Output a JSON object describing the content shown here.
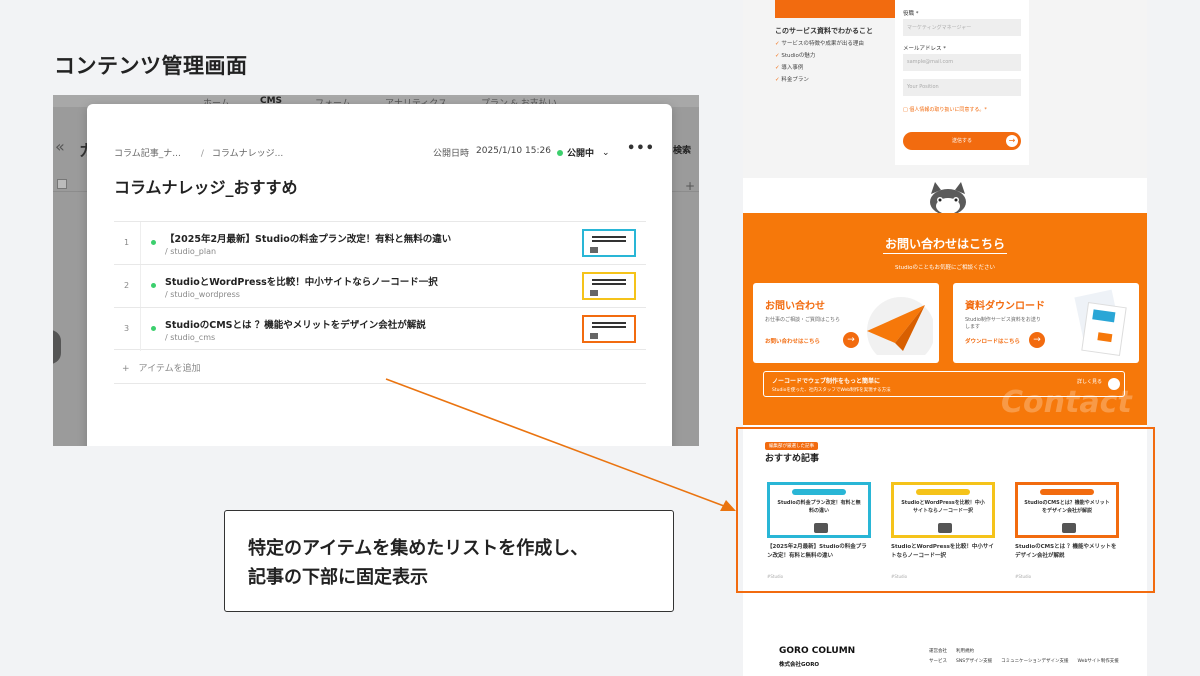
{
  "section_title": "コンテンツ管理画面",
  "cms": {
    "bg_nav": [
      "ホーム",
      "CMS",
      "フォーム",
      "アナリティクス",
      "プラン & お支払い"
    ],
    "bg_collapse": "«",
    "bg_title_fragment": "カ",
    "bg_search": "検索",
    "bg_plus": "+",
    "breadcrumb": [
      "コラム記事_ナ...",
      "コラムナレッジ..."
    ],
    "publish_label": "公開日時",
    "publish_date": "2025/1/10 15:26",
    "status": "公開中",
    "status_chevron": "⌄",
    "more": "•••",
    "title": "コラムナレッジ_おすすめ",
    "items": [
      {
        "num": "1",
        "title": "【2025年2月最新】Studioの料金プラン改定！有料と無料の違い",
        "slug": "/ studio_plan",
        "thumb_color": "#29b6d6"
      },
      {
        "num": "2",
        "title": "StudioとWordPressを比較！中小サイトならノーコード一択",
        "slug": "/ studio_wordpress",
        "thumb_color": "#f5c31a"
      },
      {
        "num": "3",
        "title": "StudioのCMSとは ？機能やメリットをデザイン会社が解説",
        "slug": "/ studio_cms",
        "thumb_color": "#f26b0f"
      }
    ],
    "add_item": "+　アイテムを追加"
  },
  "callout": {
    "line1": "特定のアイテムを集めたリストを作成し、",
    "line2": "記事の下部に固定表示"
  },
  "site": {
    "form": {
      "left_title": "このサービス資料でわかること",
      "left_items": [
        "サービスの特徴や成果が出る理由",
        "Studioの魅力",
        "導入事例",
        "料金プラン"
      ],
      "role_label": "役職 *",
      "role_placeholder": "マーケティングマネージャー",
      "email_label": "メールアドレス *",
      "email_placeholder": "sample@mail.com",
      "extra_placeholder": "Your Position",
      "agree": "□ 個人情報の取り扱いに同意する。*",
      "submit": "送信する",
      "submit_icon": "→"
    },
    "contact": {
      "title": "お問い合わせはこちら",
      "sub": "Studioのこともお気軽にご相談ください",
      "card1_title": "お問い合わせ",
      "card1_desc": "お仕事のご相談・ご質問はこちら",
      "card1_link": "お問い合わせはこちら",
      "card2_title": "資料ダウンロード",
      "card2_desc": "Studio制作サービス資料をお送りします",
      "card2_link": "ダウンロードはこちら",
      "arrow": "→",
      "nocode_title": "ノーコードでウェブ制作をもっと簡単に",
      "nocode_sub": "Studioを使った、社内スタッフでWeb制作を実現する方法",
      "nocode_btn": "詳しく見る",
      "watermark": "Contact"
    },
    "recommend": {
      "badge": "編集部が厳選した記事",
      "title": "おすすめ記事",
      "cards": [
        {
          "img_text": "Studioの料金プラン改定！有料と無料の違い",
          "title": "【2025年2月最新】Studioの料金プラン改定！有料と無料の違い",
          "tag": "#Studio",
          "color": "#29b6d6"
        },
        {
          "img_text": "StudioとWordPressを比較！中小サイトならノーコード一択",
          "title": "StudioとWordPressを比較！中小サイトならノーコード一択",
          "tag": "#Studio",
          "color": "#f5c31a"
        },
        {
          "img_text": "StudioのCMSとは？機能やメリットをデザイン会社が解説",
          "title": "StudioのCMSとは ？機能やメリットをデザイン会社が解説",
          "tag": "#Studio",
          "color": "#f26b0f"
        }
      ]
    },
    "footer": {
      "brand": "GORO COLUMN",
      "company": "株式会社GORO",
      "links1": "運営会社　　利用規約",
      "links2": "サービス　　SNSデザイン支援　　コミュニケーションデザイン支援　　Webサイト制作支援"
    }
  }
}
